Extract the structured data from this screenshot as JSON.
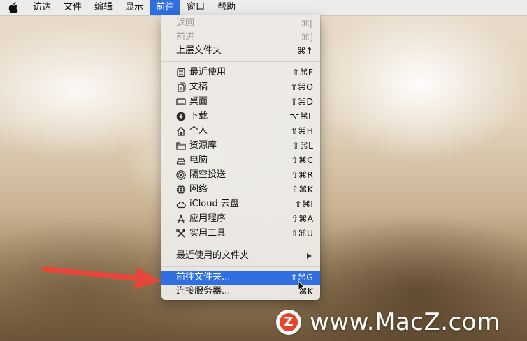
{
  "menubar": {
    "apple_icon": "apple-logo-icon",
    "items": [
      "访达",
      "文件",
      "编辑",
      "显示",
      "前往",
      "窗口",
      "帮助"
    ],
    "active_item": "前往"
  },
  "go_menu": {
    "back": {
      "label": "返回",
      "shortcut": "⌘["
    },
    "forward": {
      "label": "前进",
      "shortcut": "⌘]"
    },
    "enclosing": {
      "label": "上层文件夹",
      "shortcut": "⌘↑"
    },
    "places": [
      {
        "label": "最近使用",
        "shortcut": "⇧⌘F",
        "icon": "recents-icon"
      },
      {
        "label": "文稿",
        "shortcut": "⇧⌘O",
        "icon": "documents-icon"
      },
      {
        "label": "桌面",
        "shortcut": "⇧⌘D",
        "icon": "desktop-icon"
      },
      {
        "label": "下载",
        "shortcut": "⌥⌘L",
        "icon": "downloads-icon"
      },
      {
        "label": "个人",
        "shortcut": "⇧⌘H",
        "icon": "home-icon"
      },
      {
        "label": "资源库",
        "shortcut": "⇧⌘L",
        "icon": "library-folder-icon"
      },
      {
        "label": "电脑",
        "shortcut": "⇧⌘C",
        "icon": "computer-icon"
      },
      {
        "label": "隔空投送",
        "shortcut": "⇧⌘R",
        "icon": "airdrop-icon"
      },
      {
        "label": "网络",
        "shortcut": "⇧⌘K",
        "icon": "network-icon"
      },
      {
        "label": "iCloud 云盘",
        "shortcut": "⇧⌘I",
        "icon": "icloud-icon"
      },
      {
        "label": "应用程序",
        "shortcut": "⇧⌘A",
        "icon": "applications-icon"
      },
      {
        "label": "实用工具",
        "shortcut": "⇧⌘U",
        "icon": "utilities-icon"
      }
    ],
    "recent_folders": {
      "label": "最近使用的文件夹"
    },
    "go_to_folder": {
      "label": "前往文件夹...",
      "shortcut": "⇧⌘G"
    },
    "connect_server": {
      "label": "连接服务器...",
      "shortcut": "⌘K"
    }
  },
  "watermark": {
    "text": "www.MacZ.com",
    "logo_letter": "Z"
  },
  "colors": {
    "highlight": "#2f6fe0",
    "arrow": "#e5473a"
  }
}
